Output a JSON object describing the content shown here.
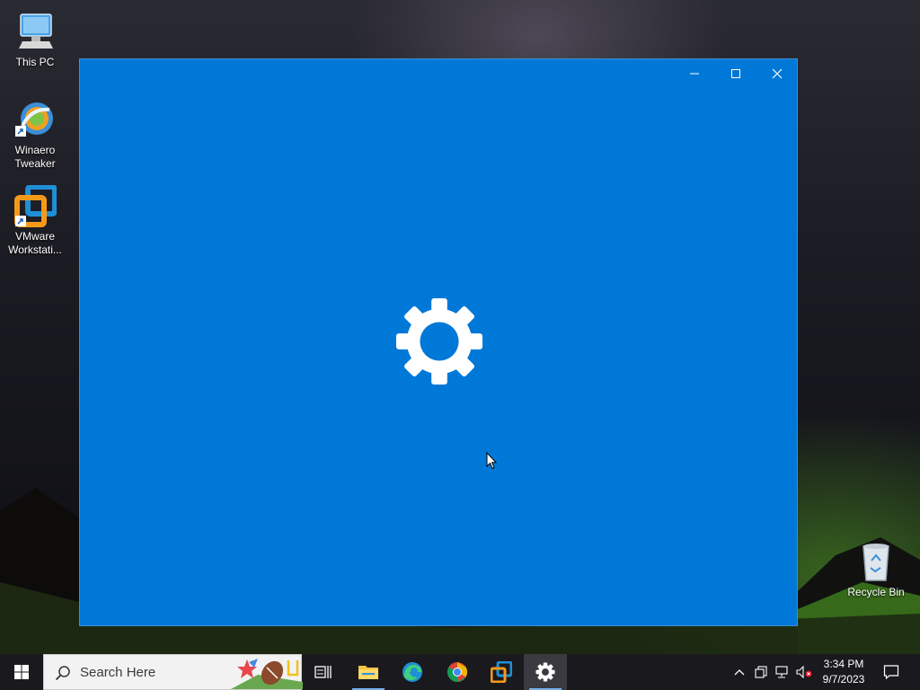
{
  "desktop": {
    "icons": [
      {
        "label": "This PC",
        "icon": "computer-icon"
      },
      {
        "label": "Winaero Tweaker",
        "icon": "winaero-tweaker-icon"
      },
      {
        "label": "VMware Workstati...",
        "icon": "vmware-icon"
      },
      {
        "label": "Recycle Bin",
        "icon": "recycle-bin-icon"
      }
    ]
  },
  "window": {
    "background": "#0078d7",
    "splash_icon": "gear-icon",
    "controls": [
      "minimize",
      "maximize",
      "close"
    ]
  },
  "taskbar": {
    "search_placeholder": "Search Here",
    "pinned": [
      "task-view-icon",
      "file-explorer-icon",
      "edge-icon",
      "chrome-icon",
      "vmware-icon",
      "settings-icon"
    ],
    "active": "settings-icon",
    "tray": [
      "chevron-up-icon",
      "tablet-icon",
      "network-icon",
      "volume-muted-icon"
    ],
    "time": "3:34 PM",
    "date": "9/7/2023",
    "accent": "#78aee8"
  }
}
